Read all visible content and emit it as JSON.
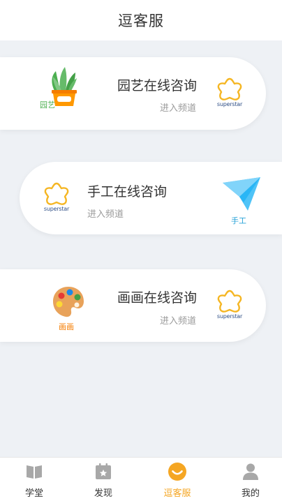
{
  "header": {
    "title": "逗客服"
  },
  "channels": [
    {
      "title": "园艺在线咨询",
      "link": "进入频道",
      "badge": "园艺",
      "logo_text": "superstar"
    },
    {
      "title": "手工在线咨询",
      "link": "进入频道",
      "badge": "手工",
      "logo_text": "superstar"
    },
    {
      "title": "画画在线咨询",
      "link": "进入频道",
      "badge": "画画",
      "logo_text": "superstar"
    }
  ],
  "tabbar": {
    "items": [
      {
        "label": "学堂",
        "icon": "book-icon"
      },
      {
        "label": "发现",
        "icon": "calendar-star-icon"
      },
      {
        "label": "逗客服",
        "icon": "smile-icon",
        "active": true
      },
      {
        "label": "我的",
        "icon": "user-icon"
      }
    ]
  },
  "colors": {
    "accent": "#f5a623",
    "background": "#eef1f5",
    "text": "#333333"
  }
}
